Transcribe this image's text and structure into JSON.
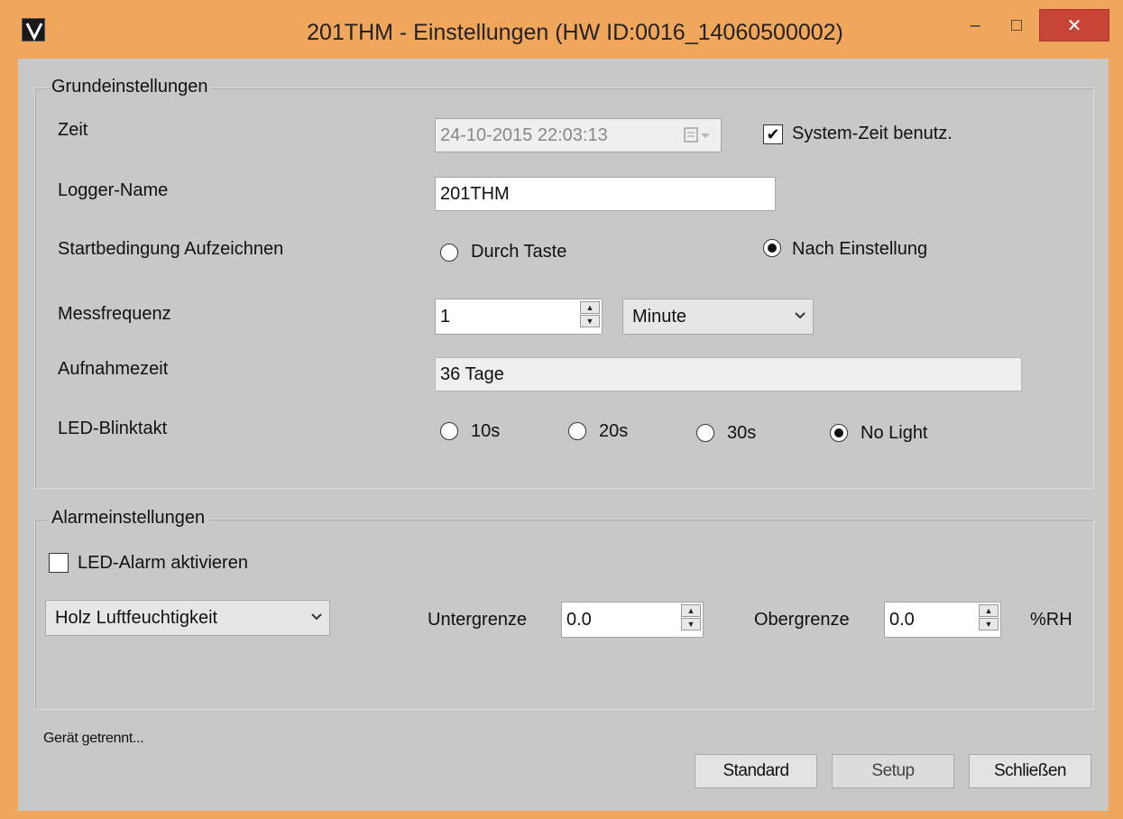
{
  "window": {
    "title": "201THM - Einstellungen (HW ID:0016_14060500002)",
    "minimize_label": "–",
    "maximize_label": "□",
    "close_label": "✕"
  },
  "basic": {
    "group_title": "Grundeinstellungen",
    "time_label": "Zeit",
    "time_value": "24-10-2015 22:03:13",
    "system_time_label": "System-Zeit benutz.",
    "system_time_checked": true,
    "logger_name_label": "Logger-Name",
    "logger_name_value": "201THM",
    "start_condition_label": "Startbedingung Aufzeichnen",
    "start_options": [
      "Durch Taste",
      "Nach Einstellung"
    ],
    "start_selected": "Nach Einstellung",
    "frequency_label": "Messfrequenz",
    "frequency_value": "1",
    "frequency_unit": "Minute",
    "recording_time_label": "Aufnahmezeit",
    "recording_time_value": "36 Tage",
    "led_label": "LED-Blinktakt",
    "led_options": [
      "10s",
      "20s",
      "30s",
      "No Light"
    ],
    "led_selected": "No Light"
  },
  "alarm": {
    "group_title": "Alarmeinstellungen",
    "led_alarm_label": "LED-Alarm aktivieren",
    "led_alarm_checked": false,
    "sensor_value": "Holz Luftfeuchtigkeit",
    "lower_label": "Untergrenze",
    "lower_value": "0.0",
    "upper_label": "Obergrenze",
    "upper_value": "0.0",
    "unit": "%RH"
  },
  "footer": {
    "status": "Gerät getrennt...",
    "standard_button": "Standard",
    "setup_button": "Setup",
    "close_button": "Schließen"
  },
  "icons": {
    "checkmark": "✔",
    "chevron": "⌵",
    "spin_up": "▲",
    "spin_down": "▼"
  }
}
